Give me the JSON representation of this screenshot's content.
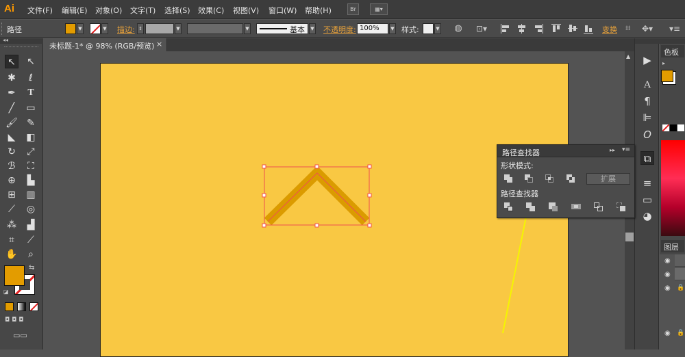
{
  "app": {
    "logo": "Ai"
  },
  "menu": {
    "items": [
      "文件(F)",
      "编辑(E)",
      "对象(O)",
      "文字(T)",
      "选择(S)",
      "效果(C)",
      "视图(V)",
      "窗口(W)",
      "帮助(H)"
    ],
    "bridge_label": "Br"
  },
  "control": {
    "object_type": "路径",
    "stroke_label": "描边:",
    "brush_label": "基本",
    "opacity_label": "不透明度:",
    "opacity_value": "100%",
    "style_label": "样式:",
    "transform_label": "变换"
  },
  "tab": {
    "title": "未标题-1* @ 98% (RGB/预览)",
    "close": "×"
  },
  "colors": {
    "fill": "#e39c00",
    "artboard": "#f9c843",
    "chevron": "#db9b00",
    "selection": "#f0504f"
  },
  "pathfinder": {
    "title": "路径查找器",
    "shape_modes_label": "形状模式:",
    "pathfinders_label": "路径查找器",
    "expand_label": "扩展"
  },
  "right_panels": {
    "swatches_tab": "色板",
    "layers_tab": "图层"
  }
}
